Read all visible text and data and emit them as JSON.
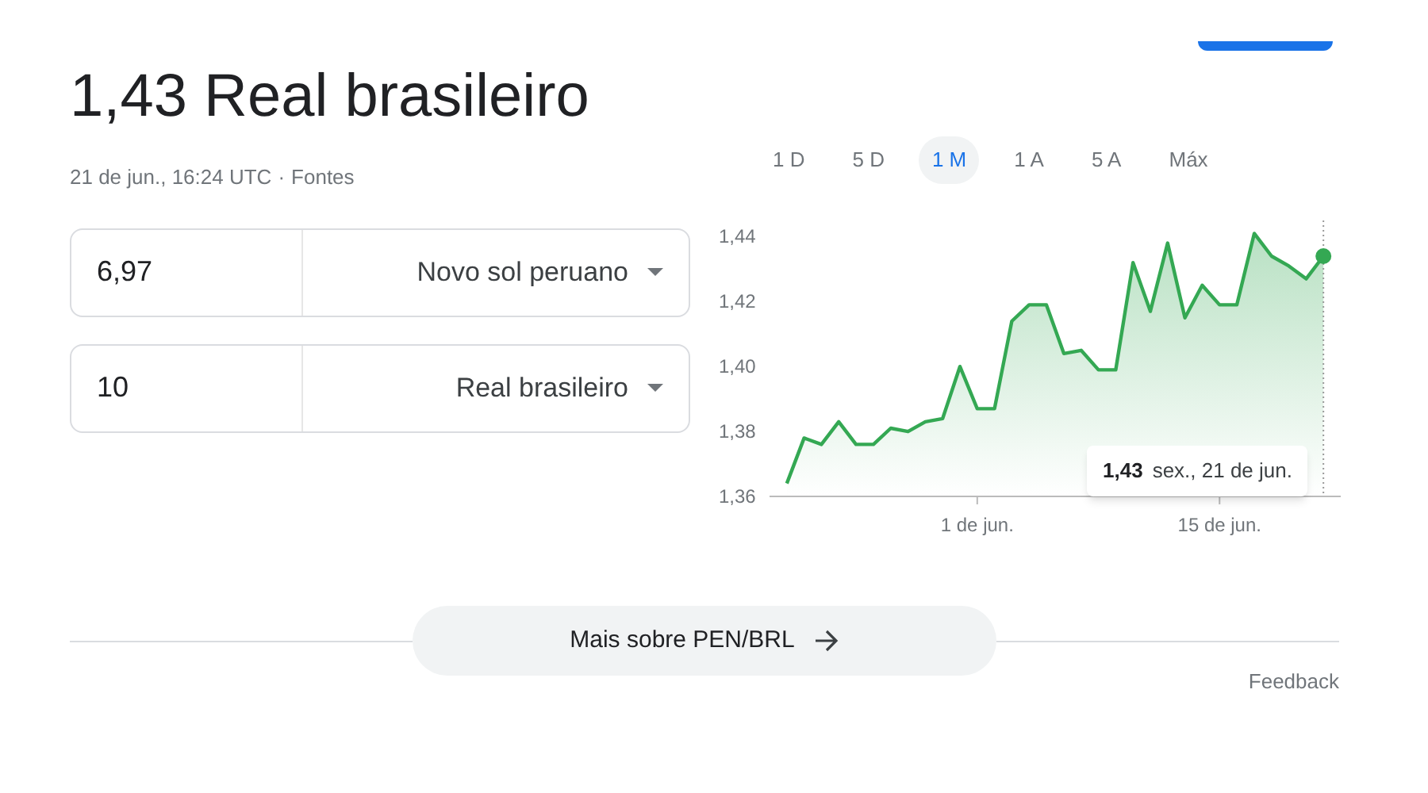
{
  "result": {
    "title": "1,43 Real brasileiro",
    "timestamp": "21 de jun., 16:24 UTC",
    "separator": "·",
    "sources_link": "Fontes"
  },
  "converter": [
    {
      "amount": "6,97",
      "currency": "Novo sol peruano"
    },
    {
      "amount": "10",
      "currency": "Real brasileiro"
    }
  ],
  "range_tabs": [
    {
      "label": "1 D",
      "selected": false
    },
    {
      "label": "5 D",
      "selected": false
    },
    {
      "label": "1 M",
      "selected": true
    },
    {
      "label": "1 A",
      "selected": false
    },
    {
      "label": "5 A",
      "selected": false
    },
    {
      "label": "Máx",
      "selected": false
    }
  ],
  "chart": {
    "chart_data": {
      "type": "area",
      "categories": [
        null,
        null,
        null,
        null,
        null,
        null,
        null,
        null,
        null,
        null,
        null,
        "1 de jun.",
        null,
        null,
        null,
        null,
        null,
        null,
        null,
        null,
        null,
        null,
        null,
        null,
        null,
        "15 de jun.",
        null,
        null,
        null,
        null,
        null,
        null
      ],
      "series": [
        {
          "color": "#34a853",
          "values": [
            1.364,
            1.378,
            1.376,
            1.383,
            1.376,
            1.376,
            1.381,
            1.38,
            1.383,
            1.384,
            1.4,
            1.387,
            1.387,
            1.414,
            1.419,
            1.419,
            1.404,
            1.405,
            1.399,
            1.399,
            1.432,
            1.417,
            1.438,
            1.415,
            1.425,
            1.419,
            1.419,
            1.441,
            1.434,
            1.431,
            1.427,
            1.434
          ]
        }
      ],
      "ylim": [
        1.36,
        1.445
      ],
      "yticks": [
        {
          "value": 1.36,
          "label": "1,36"
        },
        {
          "value": 1.38,
          "label": "1,38"
        },
        {
          "value": 1.4,
          "label": "1,40"
        },
        {
          "value": 1.42,
          "label": "1,42"
        },
        {
          "value": 1.44,
          "label": "1,44"
        }
      ]
    },
    "tooltip": {
      "value": "1,43",
      "date": "sex., 21 de jun."
    }
  },
  "more_button": {
    "label": "Mais sobre PEN/BRL"
  },
  "feedback_link": "Feedback"
}
